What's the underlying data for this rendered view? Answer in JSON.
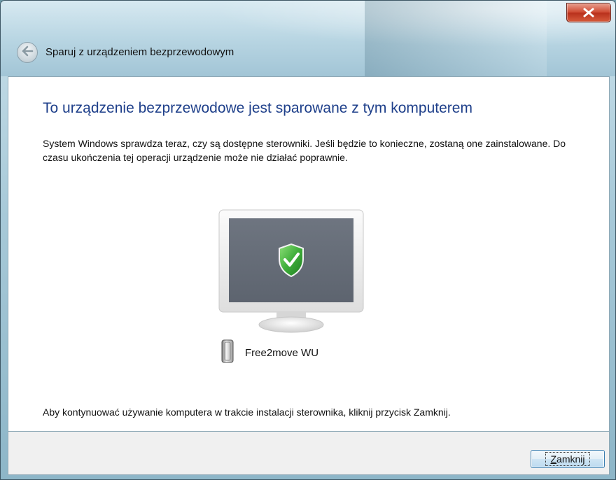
{
  "window": {
    "title": "Sparuj z urządzeniem bezprzewodowym",
    "close_icon": "close-icon",
    "back_icon": "back-arrow-icon"
  },
  "main": {
    "heading": "To urządzenie bezprzewodowe jest sparowane z tym komputerem",
    "description": "System Windows sprawdza teraz, czy są dostępne sterowniki. Jeśli będzie to konieczne, zostaną one zainstalowane. Do czasu ukończenia tej operacji urządzenie może nie działać poprawnie.",
    "illustration_icon": "monitor-shield-check-icon",
    "device": {
      "icon": "device-icon",
      "name": "Free2move WU"
    },
    "note": "Aby kontynuować używanie komputera w trakcie instalacji sterownika, kliknij przycisk Zamknij."
  },
  "footer": {
    "close_button": {
      "accel": "Z",
      "rest": "amknij"
    }
  },
  "colors": {
    "heading": "#1e3f8a",
    "close_red": "#cf4a32",
    "shield_green": "#3fae3a"
  }
}
